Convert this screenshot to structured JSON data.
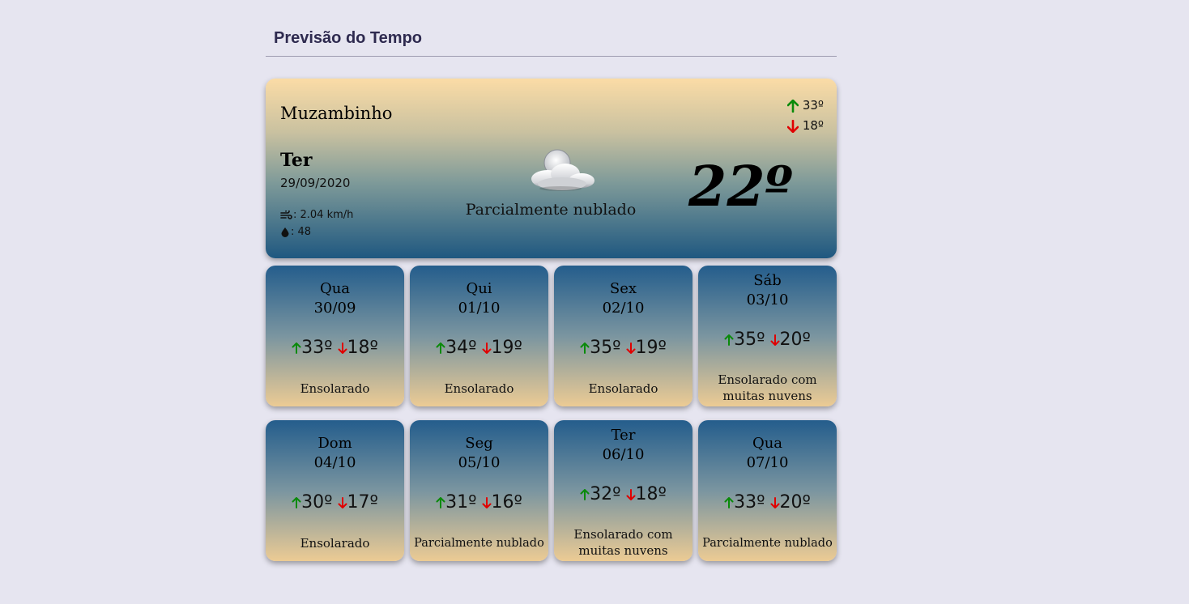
{
  "page": {
    "title": "Previsão do Tempo"
  },
  "current": {
    "city": "Muzambinho",
    "max": "33º",
    "min": "18º",
    "day": "Ter",
    "date": "29/09/2020",
    "wind": ": 2.04 km/h",
    "humidity": ": 48",
    "condition": "Parcialmente nublado",
    "temperature": "22º"
  },
  "forecast": [
    {
      "day": "Qua",
      "date": "30/09",
      "max": "33º",
      "min": "18º",
      "condition": "Ensolarado"
    },
    {
      "day": "Qui",
      "date": "01/10",
      "max": "34º",
      "min": "19º",
      "condition": "Ensolarado"
    },
    {
      "day": "Sex",
      "date": "02/10",
      "max": "35º",
      "min": "19º",
      "condition": "Ensolarado"
    },
    {
      "day": "Sáb",
      "date": "03/10",
      "max": "35º",
      "min": "20º",
      "condition": "Ensolarado com muitas nuvens"
    },
    {
      "day": "Dom",
      "date": "04/10",
      "max": "30º",
      "min": "17º",
      "condition": "Ensolarado"
    },
    {
      "day": "Seg",
      "date": "05/10",
      "max": "31º",
      "min": "16º",
      "condition": "Parcialmente nublado"
    },
    {
      "day": "Ter",
      "date": "06/10",
      "max": "32º",
      "min": "18º",
      "condition": "Ensolarado com muitas nuvens"
    },
    {
      "day": "Qua",
      "date": "07/10",
      "max": "33º",
      "min": "20º",
      "condition": "Parcialmente nublado"
    }
  ],
  "colors": {
    "up_arrow": "#0a8a0a",
    "down_arrow": "#e00000",
    "background": "#e6e5f0",
    "title": "#2e2a4f"
  },
  "icons": {
    "max": "arrow-up-icon",
    "min": "arrow-down-icon",
    "wind": "wind-icon",
    "humidity": "droplet-icon",
    "condition": "partly-cloudy-icon"
  }
}
